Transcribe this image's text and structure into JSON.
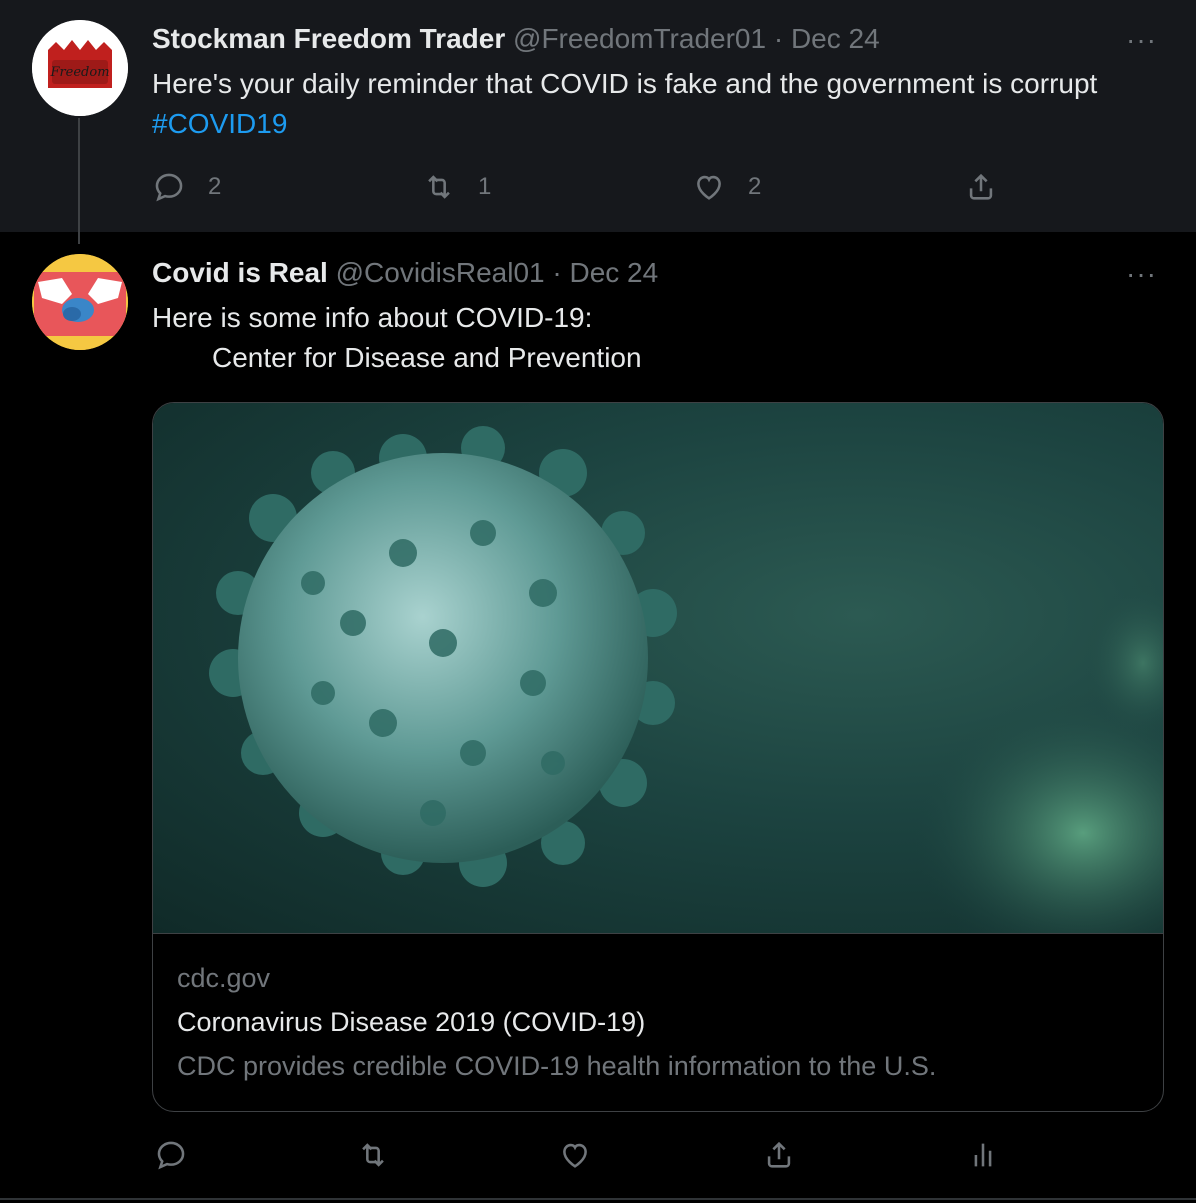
{
  "tweets": [
    {
      "author_name": "Stockman Freedom Trader",
      "handle": "@FreedomTrader01",
      "date": "· Dec 24",
      "avatar_text": "Freedom",
      "text": "Here's your daily reminder that COVID is fake and the government is corrupt",
      "hashtag": "#COVID19",
      "actions": {
        "reply_count": "2",
        "retweet_count": "1",
        "like_count": "2"
      },
      "more_label": "···"
    },
    {
      "author_name": "Covid is Real",
      "handle": "@CovidisReal01",
      "date": "· Dec 24",
      "text_line1": "Here is some info about COVID-19:",
      "text_line2": "Center for Disease and Prevention",
      "more_label": "···",
      "card": {
        "domain": "cdc.gov",
        "title": "Coronavirus Disease 2019 (COVID-19)",
        "description": "CDC provides credible COVID-19 health information to the U.S."
      }
    }
  ],
  "icons": {
    "reply": "reply-icon",
    "retweet": "retweet-icon",
    "like": "heart-icon",
    "share": "share-icon",
    "analytics": "analytics-icon"
  },
  "colors": {
    "background": "#000000",
    "focused_tweet_background": "#16181c",
    "link": "#1d9bf0",
    "secondary_text": "#71767b",
    "primary_text": "#e7e9ea"
  }
}
